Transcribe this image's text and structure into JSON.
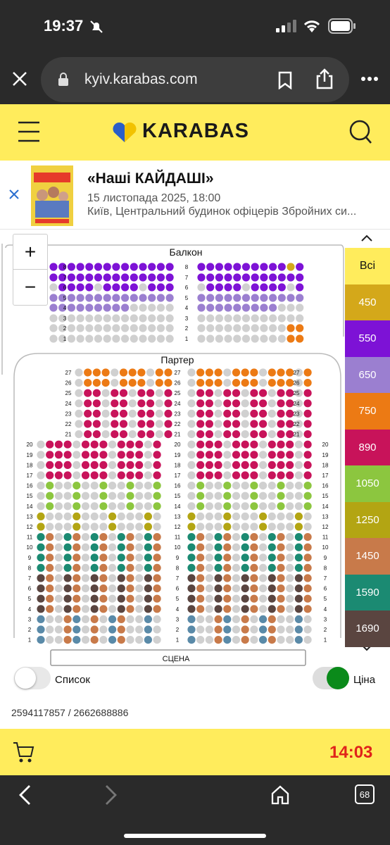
{
  "status": {
    "time": "19:37"
  },
  "browser": {
    "url": "kyiv.karabas.com",
    "tab_count": "68"
  },
  "brand": {
    "name": "KARABAS"
  },
  "event": {
    "title": "«Наші КАЙДАШІ»",
    "date": "15 листопада 2025, 18:00",
    "venue": "Київ, Центральний будинок офіцерів Збройних си..."
  },
  "map": {
    "balcony_label": "Балкон",
    "parterre_label": "Партер",
    "stage_label": "СЦЕНА",
    "zoom_in": "+",
    "zoom_out": "−"
  },
  "legend": {
    "all_label": "Всі",
    "items": [
      {
        "price": "450",
        "color": "#d4a81a"
      },
      {
        "price": "550",
        "color": "#7d12d6"
      },
      {
        "price": "650",
        "color": "#9b7fd0"
      },
      {
        "price": "750",
        "color": "#ec7a14"
      },
      {
        "price": "890",
        "color": "#c8135a"
      },
      {
        "price": "1050",
        "color": "#8cc63f"
      },
      {
        "price": "1250",
        "color": "#b3a513"
      },
      {
        "price": "1450",
        "color": "#c87a4a"
      },
      {
        "price": "1590",
        "color": "#1b8a72"
      },
      {
        "price": "1690",
        "color": "#5a4540"
      }
    ]
  },
  "toggles": {
    "list_label": "Список",
    "price_label": "Ціна",
    "list_on": false,
    "price_on": true
  },
  "order": {
    "ids": "2594117857 / 2662688886",
    "timer": "14:03"
  }
}
